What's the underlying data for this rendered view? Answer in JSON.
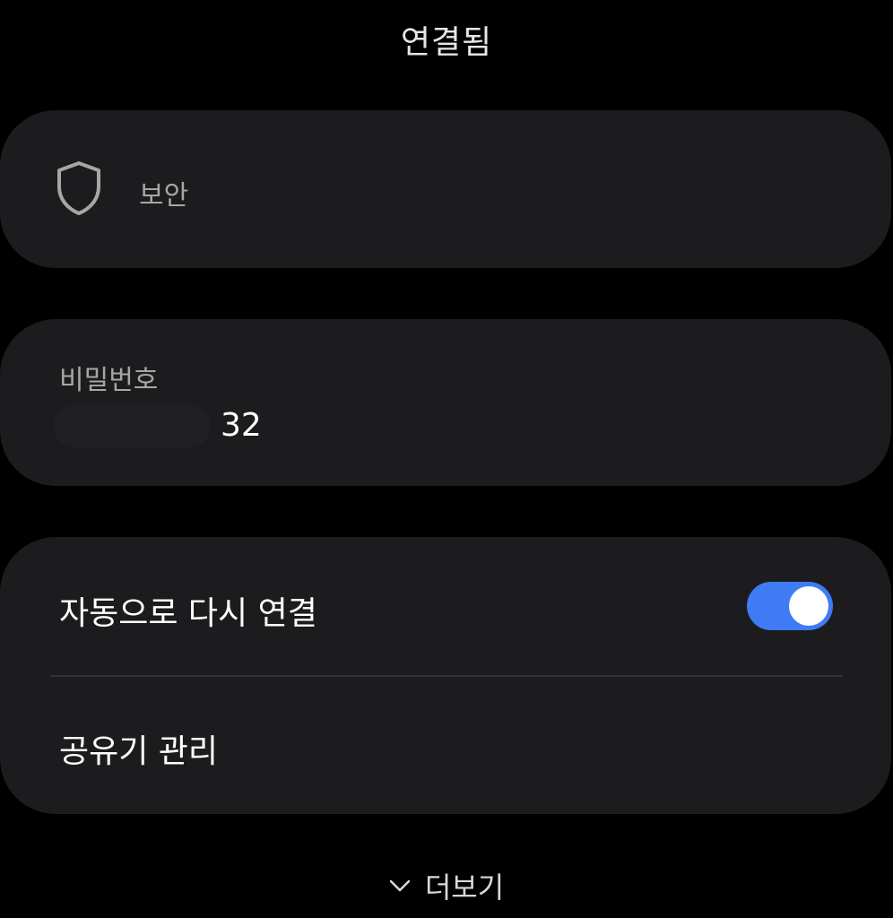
{
  "header": {
    "title": "연결됨"
  },
  "security": {
    "label": "보안",
    "icon": "shield-icon"
  },
  "password": {
    "label": "비밀번호",
    "value_suffix": "32"
  },
  "options": {
    "auto_reconnect_label": "자동으로 다시 연결",
    "auto_reconnect_enabled": true,
    "router_manage_label": "공유기 관리"
  },
  "footer": {
    "more_label": "더보기",
    "icon": "chevron-down-icon"
  },
  "colors": {
    "background": "#000000",
    "card": "#1c1c1e",
    "toggle_on": "#3e7bf4",
    "secondary_text": "#a7a7a7"
  }
}
